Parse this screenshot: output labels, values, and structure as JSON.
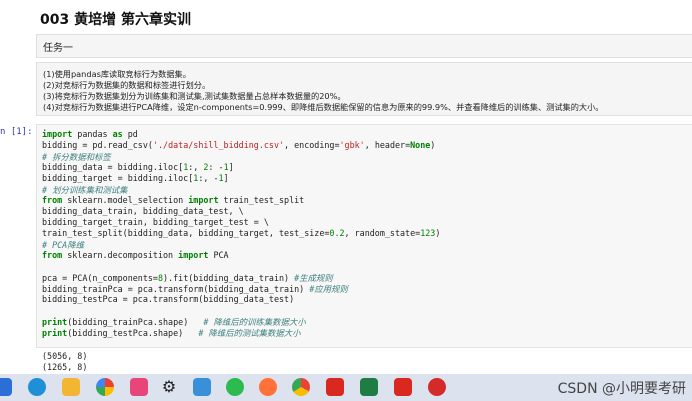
{
  "notebook": {
    "title": "003 黄培增 第六章实训",
    "task_heading": "任务一",
    "task_lines": [
      "(1)使用pandas库读取竞标行为数据集。",
      "(2)对竞标行为数据集的数据和标签进行划分。",
      "(3)将竞标行为数据集划分为训练集和测试集,测试集数据量占总样本数据量的20%。",
      "(4)对竞标行为数据集进行PCA降维，设定n-components=0.999、即降维后数据能保留的信息为原来的99.9%、并查看降维后的训练集、测试集的大小。"
    ],
    "cell_prompt": "n [1]:",
    "outputs": [
      "(5056, 8)",
      "(1265, 8)"
    ]
  },
  "taskbar": {
    "icons": [
      "start-icon",
      "edge-icon",
      "folder-icon",
      "pinwheel-icon",
      "media-icon",
      "gear-icon",
      "notepad-icon",
      "wechat-icon",
      "firefox-icon",
      "chrome-icon",
      "wps-icon",
      "excel-icon",
      "wps-writer-icon",
      "netease-music-icon"
    ]
  },
  "watermark": {
    "text": "CSDN @小明要考研"
  }
}
